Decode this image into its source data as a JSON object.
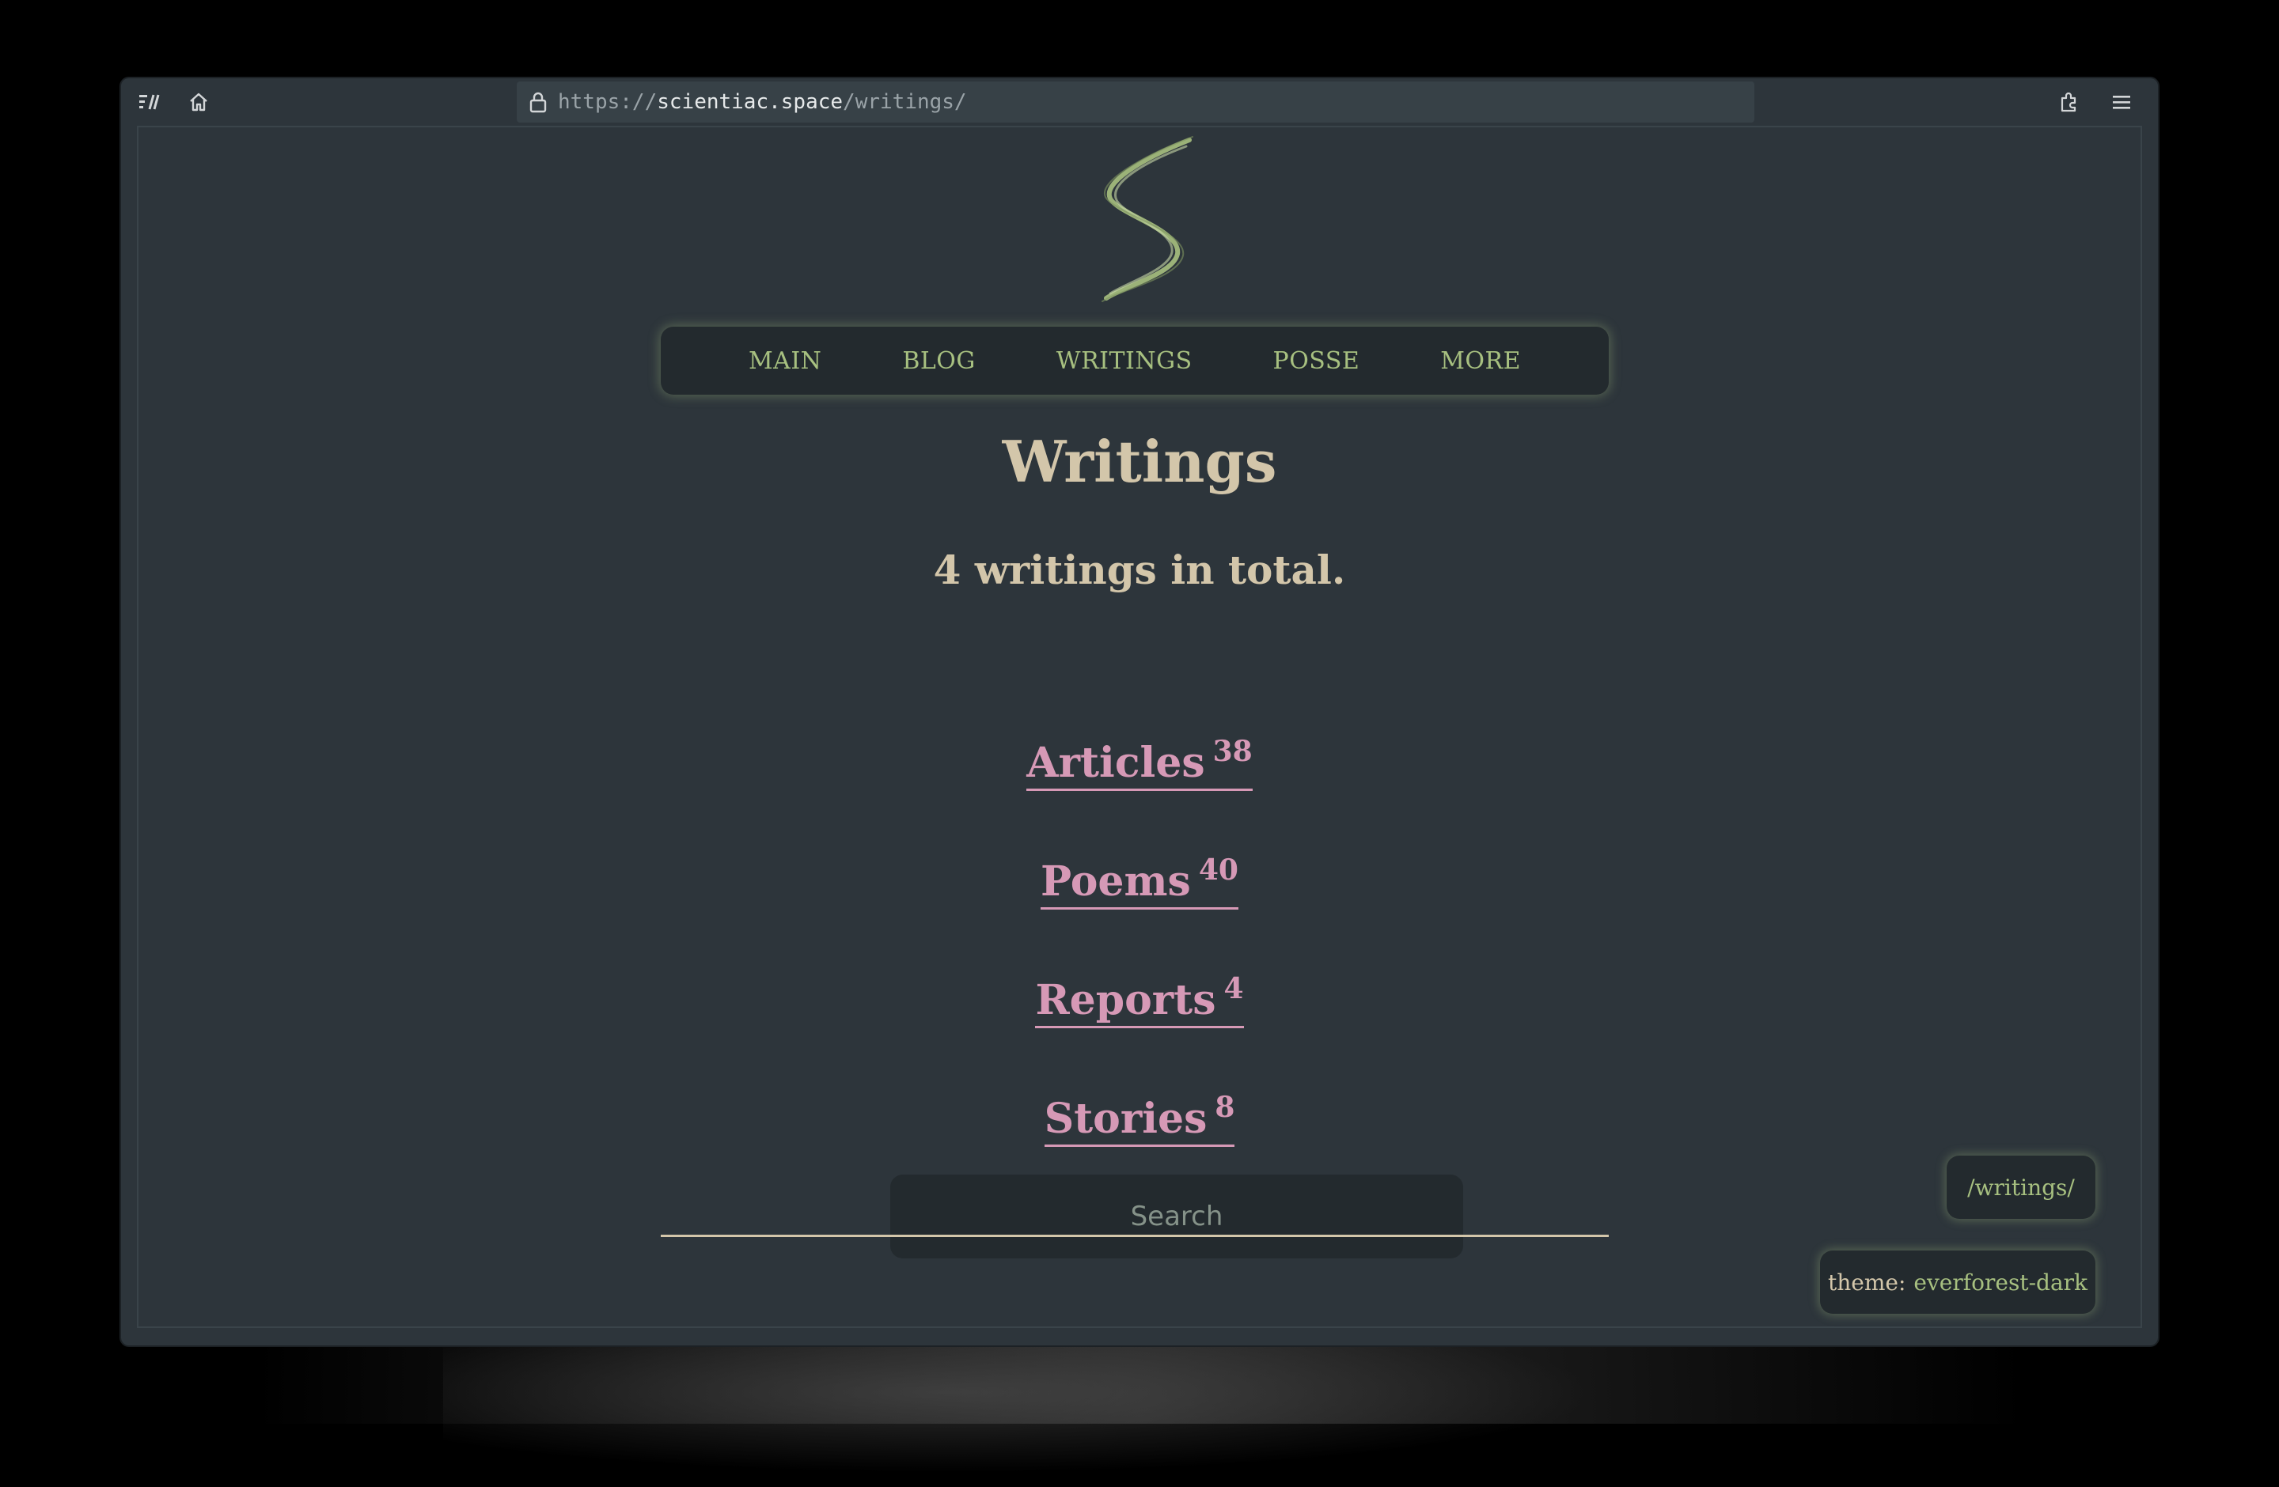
{
  "browser": {
    "url_scheme": "https://",
    "url_host": "scientiac.space",
    "url_path": "/writings/"
  },
  "nav": {
    "items": [
      {
        "label": "MAIN"
      },
      {
        "label": "BLOG"
      },
      {
        "label": "WRITINGS"
      },
      {
        "label": "POSSE"
      },
      {
        "label": "MORE"
      }
    ]
  },
  "page": {
    "title": "Writings",
    "subtitle": "4 writings in total."
  },
  "categories": [
    {
      "label": "Articles",
      "count": "38"
    },
    {
      "label": "Poems",
      "count": "40"
    },
    {
      "label": "Reports",
      "count": "4"
    },
    {
      "label": "Stories",
      "count": "8"
    }
  ],
  "search": {
    "placeholder": "Search"
  },
  "badges": {
    "path": "/writings/",
    "theme_label": "theme:",
    "theme_value": "everforest-dark"
  },
  "colors": {
    "background": "#2d353b",
    "accent_green": "#a7c080",
    "text_beige": "#d3c6aa",
    "link_pink": "#d699b6"
  }
}
